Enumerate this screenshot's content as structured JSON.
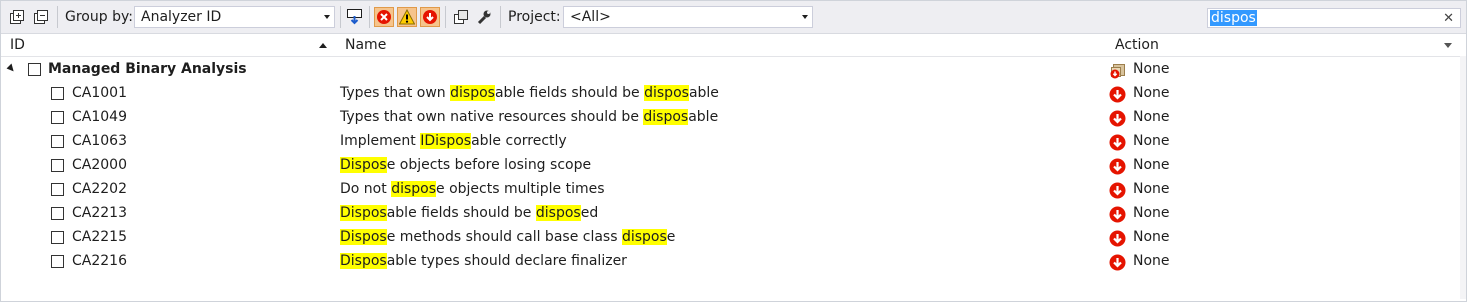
{
  "toolbar": {
    "group_by_label": "Group by:",
    "group_by_value": "Analyzer ID",
    "project_label": "Project:",
    "project_value": "<All>",
    "search_value": "dispos"
  },
  "columns": {
    "id": "ID",
    "name": "Name",
    "action": "Action"
  },
  "group": {
    "label": "Managed Binary Analysis",
    "action": "None"
  },
  "rules": [
    {
      "id": "CA1001",
      "name_parts": [
        [
          "Types that own ",
          false
        ],
        [
          "dispos",
          true
        ],
        [
          "able fields should be ",
          false
        ],
        [
          "dispos",
          true
        ],
        [
          "able",
          false
        ]
      ],
      "action": "None"
    },
    {
      "id": "CA1049",
      "name_parts": [
        [
          "Types that own native resources should be ",
          false
        ],
        [
          "dispos",
          true
        ],
        [
          "able",
          false
        ]
      ],
      "action": "None"
    },
    {
      "id": "CA1063",
      "name_parts": [
        [
          "Implement ",
          false
        ],
        [
          "IDispos",
          true
        ],
        [
          "able correctly",
          false
        ]
      ],
      "action": "None"
    },
    {
      "id": "CA2000",
      "name_parts": [
        [
          "Dispos",
          true
        ],
        [
          "e objects before losing scope",
          false
        ]
      ],
      "action": "None"
    },
    {
      "id": "CA2202",
      "name_parts": [
        [
          "Do not ",
          false
        ],
        [
          "dispos",
          true
        ],
        [
          "e objects multiple times",
          false
        ]
      ],
      "action": "None"
    },
    {
      "id": "CA2213",
      "name_parts": [
        [
          "Dispos",
          true
        ],
        [
          "able fields should be ",
          false
        ],
        [
          "dispos",
          true
        ],
        [
          "ed",
          false
        ]
      ],
      "action": "None"
    },
    {
      "id": "CA2215",
      "name_parts": [
        [
          "Dispos",
          true
        ],
        [
          "e methods should call base class ",
          false
        ],
        [
          "dispos",
          true
        ],
        [
          "e",
          false
        ]
      ],
      "action": "None"
    },
    {
      "id": "CA2216",
      "name_parts": [
        [
          "Dispos",
          true
        ],
        [
          "able types should declare finalizer",
          false
        ]
      ],
      "action": "None"
    }
  ],
  "icons": {
    "expand-all": "expand-all-icon",
    "collapse-all": "collapse-all-icon",
    "error": "error-icon",
    "warning": "warning-icon",
    "none": "none-action-icon",
    "mixed": "mixed-action-icon",
    "wrench": "wrench-icon",
    "copy": "copy-icon",
    "move": "move-rule-icon"
  },
  "colors": {
    "highlight": "#ffff00",
    "selection": "#3399ff",
    "error_red": "#e51400",
    "warning_yellow": "#ffcc00"
  }
}
